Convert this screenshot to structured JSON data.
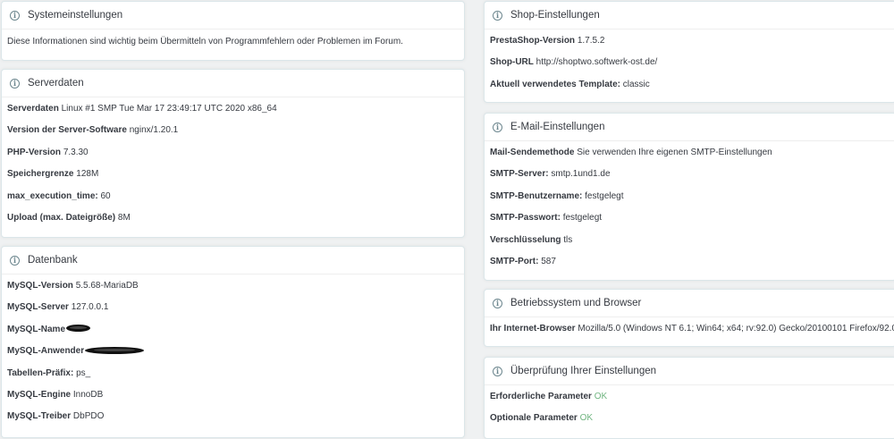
{
  "system": {
    "title": "Systemeinstellungen",
    "text": "Diese Informationen sind wichtig beim Übermitteln von Programmfehlern oder Problemen im Forum."
  },
  "server": {
    "title": "Serverdaten",
    "rows": [
      {
        "label": "Serverdaten",
        "value": "Linux #1 SMP Tue Mar 17 23:49:17 UTC 2020 x86_64"
      },
      {
        "label": "Version der Server-Software",
        "value": "nginx/1.20.1"
      },
      {
        "label": "PHP-Version",
        "value": "7.3.30"
      },
      {
        "label": "Speichergrenze",
        "value": "128M"
      },
      {
        "label": "max_execution_time:",
        "value": "60"
      },
      {
        "label": "Upload (max. Dateigröße)",
        "value": "8M"
      }
    ]
  },
  "database": {
    "title": "Datenbank",
    "rows": [
      {
        "label": "MySQL-Version",
        "value": "5.5.68-MariaDB"
      },
      {
        "label": "MySQL-Server",
        "value": "127.0.0.1"
      },
      {
        "label": "MySQL-Name",
        "value": ""
      },
      {
        "label": "MySQL-Anwender",
        "value": ""
      },
      {
        "label": "Tabellen-Präfix:",
        "value": "ps_"
      },
      {
        "label": "MySQL-Engine",
        "value": "InnoDB"
      },
      {
        "label": "MySQL-Treiber",
        "value": "DbPDO"
      }
    ]
  },
  "shop": {
    "title": "Shop-Einstellungen",
    "rows": [
      {
        "label": "PrestaShop-Version",
        "value": "1.7.5.2"
      },
      {
        "label": "Shop-URL",
        "value": "http://shoptwo.softwerk-ost.de/"
      },
      {
        "label": "Aktuell verwendetes Template:",
        "value": "classic"
      }
    ]
  },
  "mail": {
    "title": "E-Mail-Einstellungen",
    "rows": [
      {
        "label": "Mail-Sendemethode",
        "value": "Sie verwenden Ihre eigenen SMTP-Einstellungen"
      },
      {
        "label": "SMTP-Server:",
        "value": "smtp.1und1.de"
      },
      {
        "label": "SMTP-Benutzername:",
        "value": "festgelegt"
      },
      {
        "label": "SMTP-Passwort:",
        "value": "festgelegt"
      },
      {
        "label": "Verschlüsselung",
        "value": "tls"
      },
      {
        "label": "SMTP-Port:",
        "value": "587"
      }
    ]
  },
  "os": {
    "title": "Betriebssystem und Browser",
    "rows": [
      {
        "label": "Ihr Internet-Browser",
        "value": "Mozilla/5.0 (Windows NT 6.1; Win64; x64; rv:92.0) Gecko/20100101 Firefox/92.0"
      }
    ]
  },
  "check": {
    "title": "Überprüfung Ihrer Einstellungen",
    "rows": [
      {
        "label": "Erforderliche Parameter",
        "value": "OK"
      },
      {
        "label": "Optionale Parameter",
        "value": "OK"
      }
    ]
  },
  "colors": {
    "ok": "#70b580",
    "header_icon": "#6c868e",
    "background": "#eff1f2"
  },
  "icons": {
    "panel_header": "info-circle-icon"
  }
}
